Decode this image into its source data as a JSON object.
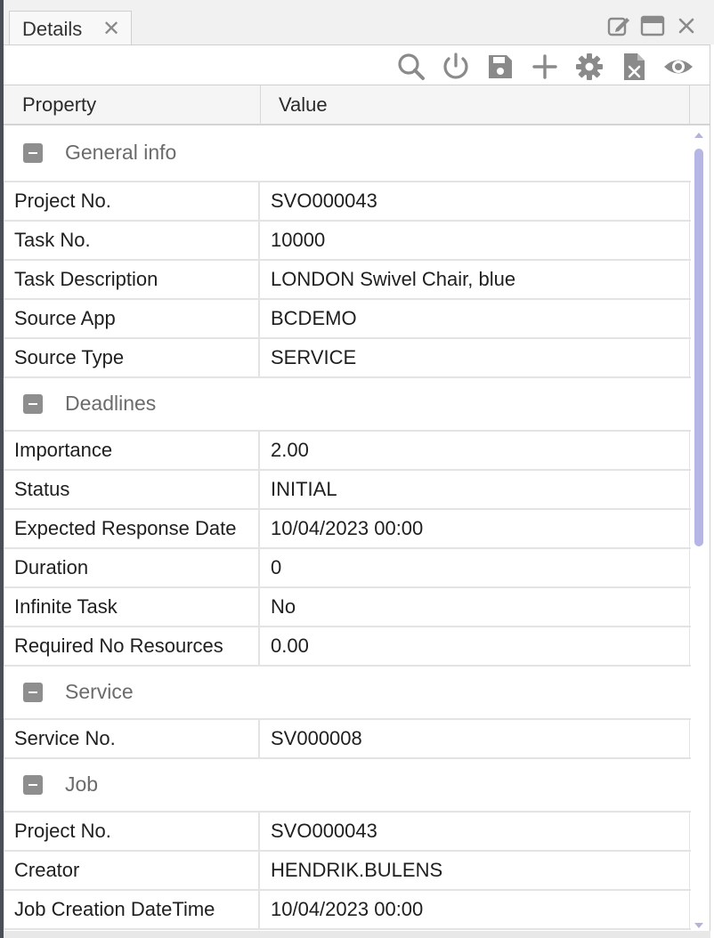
{
  "tab": {
    "label": "Details",
    "close_glyph": "✕"
  },
  "window_controls": [
    "edit-icon",
    "maximize-icon",
    "close-icon"
  ],
  "toolbar": [
    "search-icon",
    "power-icon",
    "save-icon",
    "add-icon",
    "settings-icon",
    "excel-export-icon",
    "view-icon"
  ],
  "columns": {
    "property": "Property",
    "value": "Value"
  },
  "colors": {
    "group_toggle": "#8e8e8e",
    "scrollbar_thumb": "#b6b6e6",
    "toolbar_icon": "#8a8a8a"
  },
  "groups": [
    {
      "label": "General info",
      "rows": [
        {
          "property": "Project No.",
          "value": "SVO000043"
        },
        {
          "property": "Task No.",
          "value": "10000"
        },
        {
          "property": "Task Description",
          "value": "LONDON Swivel Chair, blue"
        },
        {
          "property": "Source App",
          "value": "BCDEMO"
        },
        {
          "property": "Source Type",
          "value": "SERVICE"
        }
      ]
    },
    {
      "label": "Deadlines",
      "rows": [
        {
          "property": "Importance",
          "value": "2.00"
        },
        {
          "property": "Status",
          "value": "INITIAL"
        },
        {
          "property": "Expected Response Date",
          "value": "10/04/2023 00:00"
        },
        {
          "property": "Duration",
          "value": "0"
        },
        {
          "property": "Infinite Task",
          "value": "No"
        },
        {
          "property": "Required No Resources",
          "value": "0.00"
        }
      ]
    },
    {
      "label": "Service",
      "rows": [
        {
          "property": "Service No.",
          "value": "SV000008"
        }
      ]
    },
    {
      "label": "Job",
      "rows": [
        {
          "property": "Project No.",
          "value": "SVO000043"
        },
        {
          "property": "Creator",
          "value": "HENDRIK.BULENS"
        },
        {
          "property": "Job Creation DateTime",
          "value": "10/04/2023 00:00"
        }
      ]
    }
  ]
}
